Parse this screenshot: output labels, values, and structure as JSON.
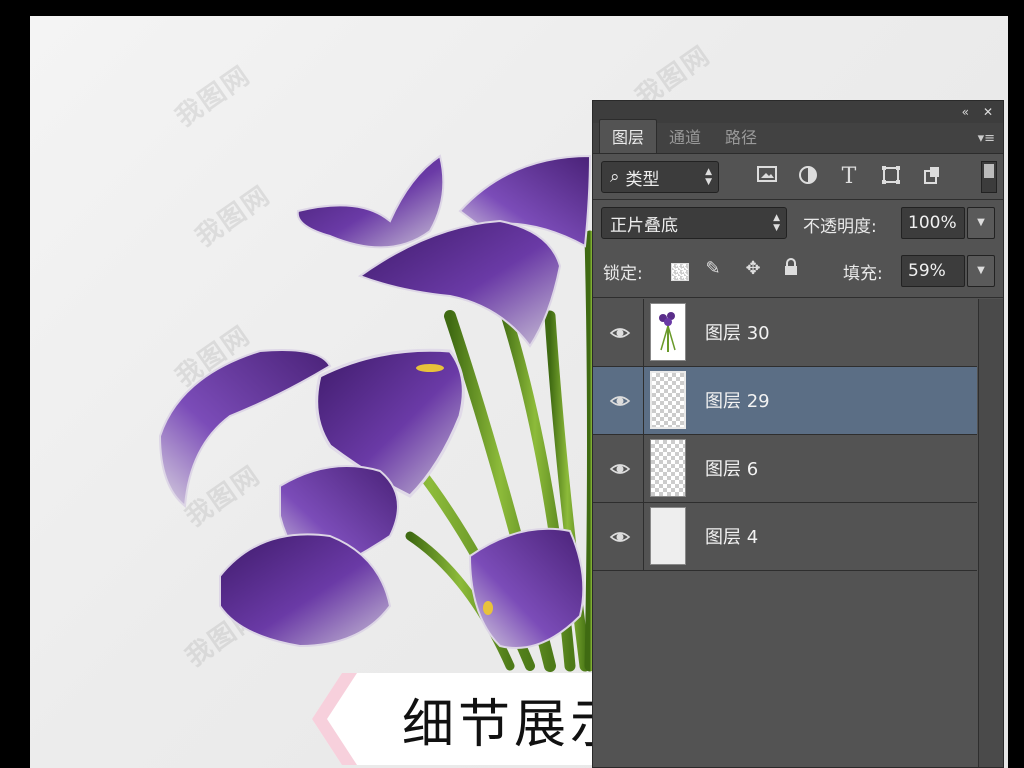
{
  "panel": {
    "header_icons": {
      "collapse": "«",
      "close": "✕"
    },
    "tabs": [
      {
        "label": "图层",
        "active": true
      },
      {
        "label": "通道",
        "active": false
      },
      {
        "label": "路径",
        "active": false
      }
    ],
    "filter": {
      "search_icon": "⌕",
      "label": "类型"
    },
    "filter_icons": [
      "image-filter-icon",
      "adjustment-filter-icon",
      "type-filter-icon",
      "shape-filter-icon",
      "smart-object-filter-icon"
    ],
    "blend_mode": "正片叠底",
    "opacity_label": "不透明度:",
    "opacity_value": "100%",
    "lock_label": "锁定:",
    "fill_label": "填充:",
    "fill_value": "59%",
    "layers": [
      {
        "name": "图层 30",
        "visible": true,
        "selected": false
      },
      {
        "name": "图层 29",
        "visible": true,
        "selected": true
      },
      {
        "name": "图层 6",
        "visible": true,
        "selected": false
      },
      {
        "name": "图层 4",
        "visible": true,
        "selected": false
      }
    ],
    "colors": {
      "panel_bg": "#535353",
      "selected_row": "#5b6e85"
    }
  },
  "canvas": {
    "banner_text": "细节展示",
    "watermark": "我图网",
    "colors": {
      "petal": "#5a2e8a",
      "stem": "#6a9a2a"
    }
  }
}
